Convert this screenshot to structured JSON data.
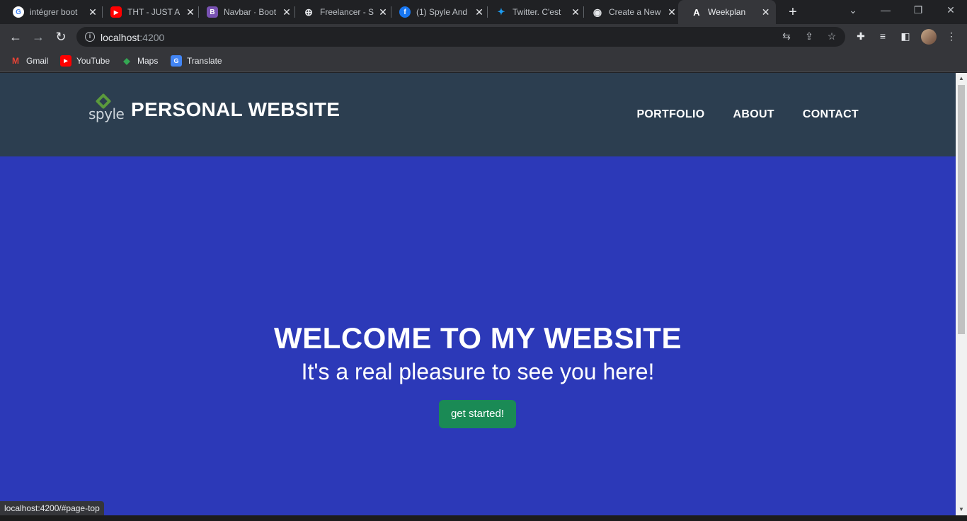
{
  "browser": {
    "tabs": [
      {
        "title": "intégrer boot",
        "icon": "G",
        "icon_name": "google-icon",
        "icon_color": "#ffffff"
      },
      {
        "title": "THT - JUST A",
        "icon": "▶",
        "icon_name": "youtube-icon",
        "icon_color": "#ff0000"
      },
      {
        "title": "Navbar · Boot",
        "icon": "B",
        "icon_name": "bootstrap-icon",
        "icon_color": "#7952b3"
      },
      {
        "title": "Freelancer - S",
        "icon": "⊕",
        "icon_name": "globe-icon",
        "icon_color": "#202124"
      },
      {
        "title": "(1) Spyle And",
        "icon": "f",
        "icon_name": "facebook-icon",
        "icon_color": "#1877f2"
      },
      {
        "title": "Twitter. C'est",
        "icon": "✦",
        "icon_name": "twitter-icon",
        "icon_color": "#1d9bf0"
      },
      {
        "title": "Create a New",
        "icon": "◉",
        "icon_name": "github-icon",
        "icon_color": "#202124"
      },
      {
        "title": "Weekplan",
        "icon": "A",
        "icon_name": "angular-icon",
        "icon_color": "#202124"
      }
    ],
    "active_tab": 7,
    "new_tab": "+",
    "address": {
      "host": "localhost",
      "port": ":4200"
    },
    "bookmarks": [
      {
        "label": "Gmail",
        "icon": "M",
        "icon_name": "gmail-icon",
        "icon_color": "#ea4335"
      },
      {
        "label": "YouTube",
        "icon": "▶",
        "icon_name": "youtube-icon",
        "icon_color": "#ff0000"
      },
      {
        "label": "Maps",
        "icon": "◆",
        "icon_name": "maps-icon",
        "icon_color": "#34a853"
      },
      {
        "label": "Translate",
        "icon": "G",
        "icon_name": "translate-icon",
        "icon_color": "#4285f4"
      }
    ],
    "status_url": "localhost:4200/#page-top"
  },
  "site": {
    "logo_text": "spyle",
    "brand": "PERSONAL WEBSITE",
    "nav": [
      "PORTFOLIO",
      "ABOUT",
      "CONTACT"
    ],
    "hero": {
      "title": "WELCOME TO MY WEBSITE",
      "subtitle": "It's a real pleasure to see you here!",
      "cta": "get started!"
    },
    "colors": {
      "navbar": "#2c3e50",
      "hero": "#2c39b8",
      "cta": "#1a8a55"
    }
  }
}
